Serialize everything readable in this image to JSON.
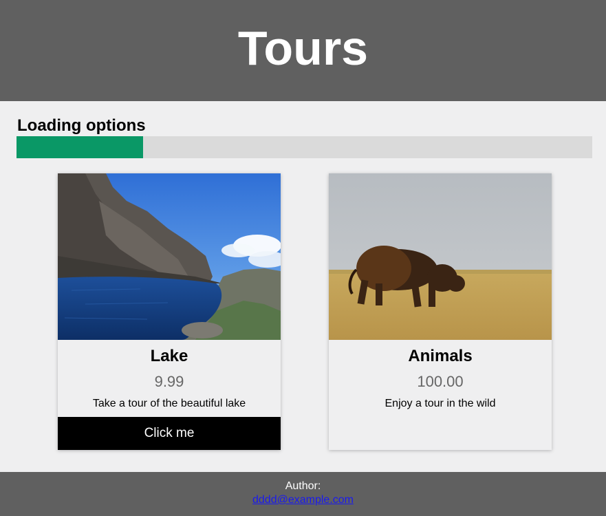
{
  "header": {
    "title": "Tours"
  },
  "loading": {
    "label": "Loading options",
    "progress": 0.22,
    "color": "#0a9866"
  },
  "cards": [
    {
      "title": "Lake",
      "price": "9.99",
      "description": "Take a tour of the beautiful lake",
      "button_label": "Click me",
      "image_icon": "lake-photo"
    },
    {
      "title": "Animals",
      "price": "100.00",
      "description": "Enjoy a tour in the wild",
      "image_icon": "bison-photo"
    }
  ],
  "footer": {
    "label": "Author:",
    "email": "dddd@example.com"
  }
}
